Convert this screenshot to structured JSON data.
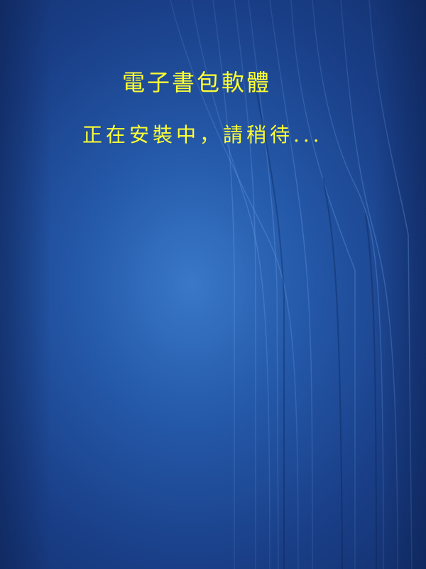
{
  "splash": {
    "title": "電子書包軟體",
    "status_text": "正在安裝中，請稍待...",
    "text_color": "#ffff33",
    "background_color": "#1f4a96"
  }
}
